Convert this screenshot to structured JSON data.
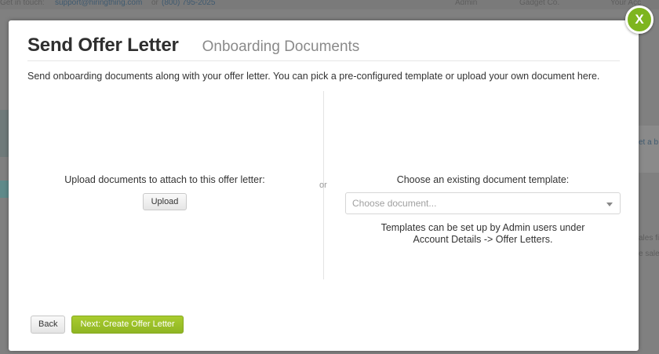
{
  "background": {
    "contact_text": "Get in touch:",
    "contact_email": "support@hiringthing.com",
    "contact_or": "or",
    "contact_phone": "(800) 795-2025",
    "admin_label": "Admin",
    "company_label": "Gadget Co.",
    "account_label": "Your Acc",
    "side_text_1": "et a b",
    "side_text_2": "ales fi",
    "side_text_3": "e sale"
  },
  "modal": {
    "title": "Send Offer Letter",
    "subtitle": "Onboarding Documents",
    "description": "Send onboarding documents along with your offer letter. You can pick a pre-configured template or upload your own document here.",
    "or_text": "or",
    "upload": {
      "label": "Upload documents to attach to this offer letter:",
      "button": "Upload"
    },
    "template": {
      "label": "Choose an existing document template:",
      "placeholder": "Choose document...",
      "note_line1": "Templates can be set up by Admin users under",
      "note_line2": "Account Details -> Offer Letters."
    },
    "footer": {
      "back": "Back",
      "next": "Next: Create Offer Letter"
    },
    "close_label": "X"
  },
  "colors": {
    "accent_green": "#8fb523",
    "close_green": "#7eb51f"
  },
  "icons": [
    "close-icon",
    "chevron-down-icon"
  ]
}
